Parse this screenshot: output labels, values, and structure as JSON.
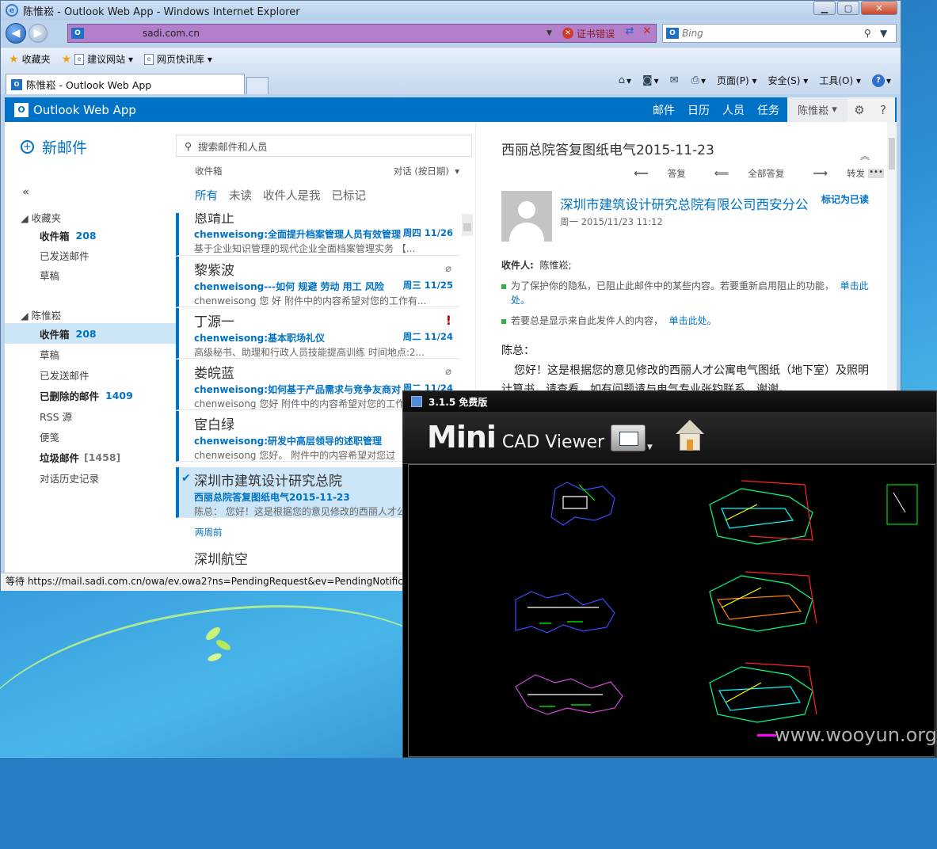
{
  "window": {
    "title": "陈惟崧 - Outlook Web App - Windows Internet Explorer"
  },
  "browser": {
    "url": "sadi.com.cn",
    "cert_error": "证书错误",
    "search_placeholder": "Bing",
    "favorites": [
      {
        "label": "收藏夹",
        "icon": "star-icon"
      },
      {
        "label": "建议网站",
        "icon": "page-icon"
      },
      {
        "label": "网页快讯库",
        "icon": "page-icon"
      }
    ],
    "tab_title": "陈惟崧 - Outlook Web App",
    "commands": {
      "page": "页面(P)",
      "safety": "安全(S)",
      "tools": "工具(O)"
    }
  },
  "owa": {
    "app_name": "Outlook Web App",
    "nav": [
      "邮件",
      "日历",
      "人员",
      "任务"
    ],
    "user": "陈惟崧"
  },
  "folders": {
    "new_mail": "新邮件",
    "favorites_header": "收藏夹",
    "favorites": [
      {
        "label": "收件箱",
        "count": "208"
      },
      {
        "label": "已发送邮件"
      },
      {
        "label": "草稿"
      }
    ],
    "account_header": "陈惟崧",
    "items": [
      {
        "label": "收件箱",
        "count": "208"
      },
      {
        "label": "草稿"
      },
      {
        "label": "已发送邮件"
      },
      {
        "label": "已删除的邮件",
        "count": "1409"
      },
      {
        "label": "RSS 源"
      },
      {
        "label": "便笺"
      },
      {
        "label": "垃圾邮件",
        "count": "[1458]"
      },
      {
        "label": "对话历史记录"
      }
    ]
  },
  "list": {
    "search_placeholder": "搜索邮件和人员",
    "caption": "收件箱",
    "sort": "对话 (按日期)",
    "filters": [
      "所有",
      "未读",
      "收件人是我",
      "已标记"
    ],
    "messages": [
      {
        "from": "恩靖止",
        "subject": "chenweisong:全面提升档案管理人员有效管理",
        "preview": "基于企业知识管理的现代企业全面档案管理实务 【...",
        "date": "周四 11/26"
      },
      {
        "from": "黎紫波",
        "subject": "chenweisong---如何 规避 劳动 用工 风险",
        "preview": "chenweisong 您 好 附件中的内容希望对您的工作有...",
        "date": "周三 11/25"
      },
      {
        "from": "丁源一",
        "subject": "chenweisong:基本职场礼仪",
        "preview": "高级秘书、助理和行政人员技能提高训练 时间地点:2...",
        "date": "周二 11/24"
      },
      {
        "from": "娄皖蓝",
        "subject": "chenweisong:如何基于产品需求与竞争友商对",
        "preview": "chenweisong 您好 附件中的内容希望对您的工作",
        "date": "周二 11/24"
      },
      {
        "from": "宦白绿",
        "subject": "chenweisong:研发中高层领导的述职管理",
        "preview": "chenweisong 您好。 附件中的内容希望对您过",
        "date": ""
      },
      {
        "from": "深圳市建筑设计研究总院",
        "subject": "西丽总院答复图纸电气2015-11-23",
        "preview": "陈总： 您好！这是根据您的意见修改的西丽人才公",
        "date": ""
      }
    ],
    "group_label": "两周前",
    "last_from": "深圳航空"
  },
  "reading": {
    "subject": "西丽总院答复图纸电气2015-11-23",
    "actions": [
      "答复",
      "全部答复",
      "转发"
    ],
    "sender": "深圳市建筑设计研究总院有限公司西安分公",
    "mark_read": "标记为已读",
    "date": "周一 2015/11/23 11:12",
    "recipient_label": "收件人:",
    "recipient": "陈惟崧;",
    "note1": "为了保护你的隐私，已阻止此邮件中的某些内容。若要重新启用阻止的功能，",
    "note1_link": "单击此处。",
    "note2": "若要总是显示来自此发件人的内容，",
    "note2_link": "单击此处。",
    "greeting": "陈总：",
    "body": "您好！这是根据您的意见修改的西丽人才公寓电气图纸（地下室）及照明计算书，请查看，如有问题请与电气专业张钧联系，谢谢。"
  },
  "status_text": "等待 https://mail.sadi.com.cn/owa/ev.owa2?ns=PendingRequest&ev=PendingNotification",
  "cad": {
    "title": "3.1.5 免费版",
    "logo_mini": "Mini",
    "logo_rest": "CAD Viewer"
  },
  "watermark": "www.wooyun.org",
  "colors": {
    "owa_blue": "#0072c6",
    "cad_bg": "#000000"
  }
}
